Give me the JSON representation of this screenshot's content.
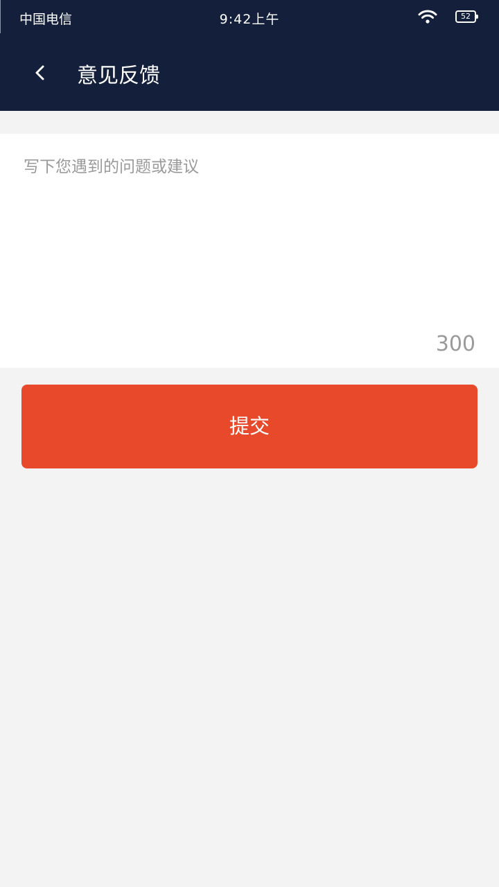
{
  "status_bar": {
    "carrier": "中国电信",
    "time": "9:42上午",
    "battery_level": "52",
    "icons": [
      "wifi-icon",
      "battery-icon"
    ]
  },
  "header": {
    "back_icon": "chevron-left-icon",
    "title": "意见反馈"
  },
  "feedback": {
    "placeholder": "写下您遇到的问题或建议",
    "value": "",
    "char_limit": "300"
  },
  "submit": {
    "label": "提交"
  },
  "colors": {
    "header_bg": "#141f3b",
    "accent": "#e8492b",
    "page_bg": "#f2f3f2"
  }
}
